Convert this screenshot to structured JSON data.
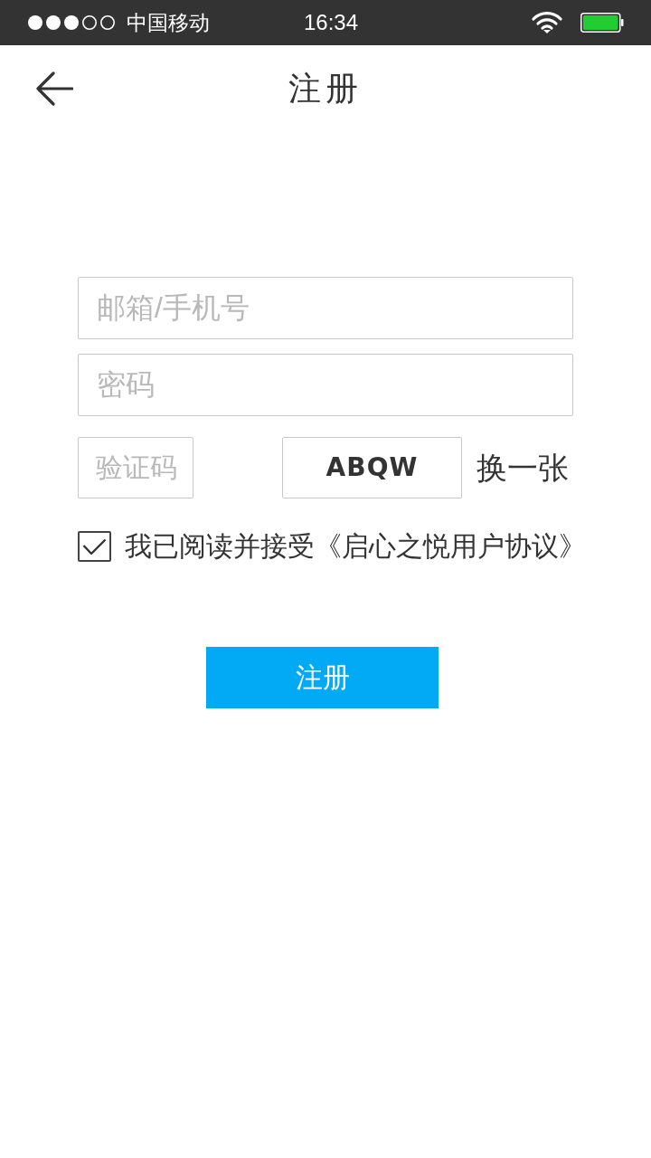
{
  "status_bar": {
    "carrier": "中国移动",
    "time": "16:34"
  },
  "header": {
    "title": "注册"
  },
  "form": {
    "fields": [
      {
        "placeholder": "邮箱/手机号"
      },
      {
        "placeholder": "密码"
      }
    ],
    "captcha": {
      "placeholder": "验证码",
      "code": "ABQW",
      "refresh": "换一张"
    },
    "agreement": {
      "checked": true,
      "text": "我已阅读并接受《启心之悦用户协议》"
    },
    "submit": "注册"
  }
}
